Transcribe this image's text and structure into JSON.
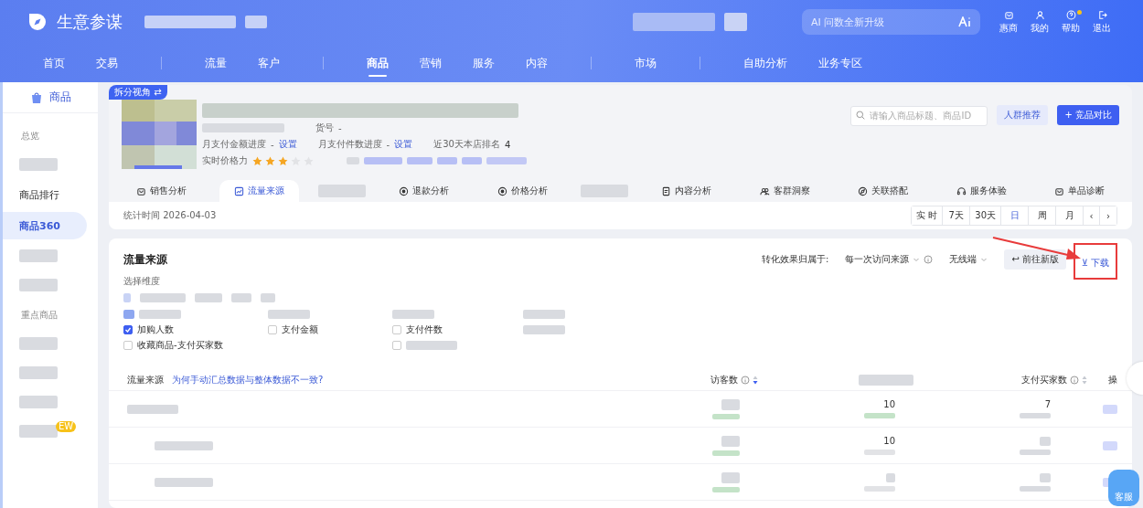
{
  "header": {
    "brand": "生意参谋",
    "ai_search": {
      "placeholder": "AI 问数全新升级"
    },
    "tools": [
      {
        "kind": "bag",
        "label": "惠商",
        "dot": false
      },
      {
        "kind": "user",
        "label": "我的",
        "dot": false
      },
      {
        "kind": "help",
        "label": "帮助",
        "dot": true
      },
      {
        "kind": "exit",
        "label": "退出",
        "dot": false
      }
    ],
    "nav": [
      {
        "label": "首页",
        "selected": false,
        "divider_after": false
      },
      {
        "label": "交易",
        "selected": false,
        "divider_after": true
      },
      {
        "label": "流量",
        "selected": false,
        "divider_after": false
      },
      {
        "label": "客户",
        "selected": false,
        "divider_after": true
      },
      {
        "label": "商品",
        "selected": true,
        "divider_after": false
      },
      {
        "label": "营销",
        "selected": false,
        "divider_after": false
      },
      {
        "label": "服务",
        "selected": false,
        "divider_after": false
      },
      {
        "label": "内容",
        "selected": false,
        "divider_after": true
      },
      {
        "label": "市场",
        "selected": false,
        "divider_after": true
      },
      {
        "label": "自助分析",
        "selected": false,
        "divider_after": false
      },
      {
        "label": "业务专区",
        "selected": false,
        "divider_after": false
      }
    ]
  },
  "sidebar": {
    "title": "商品",
    "items": [
      {
        "kind": "group",
        "label": "总览"
      },
      {
        "kind": "redacted"
      },
      {
        "kind": "item",
        "label": "商品排行",
        "selected": false
      },
      {
        "kind": "item",
        "label": "商品360",
        "selected": true
      },
      {
        "kind": "redacted"
      },
      {
        "kind": "redacted"
      },
      {
        "kind": "group",
        "label": "重点商品"
      },
      {
        "kind": "redacted"
      },
      {
        "kind": "redacted"
      },
      {
        "kind": "redacted"
      },
      {
        "kind": "redacted",
        "badge": "EW"
      }
    ]
  },
  "product": {
    "tag": "拆分视角 ⇄",
    "sku_label": "货号",
    "sku_value": "-",
    "progress": [
      {
        "label": "月支付金额进度",
        "value": "-",
        "link": "设置"
      },
      {
        "label": "月支付件数进度",
        "value": "-",
        "link": "设置"
      }
    ],
    "rank_label": "近30天本店排名",
    "rank_value": "4",
    "price_power_label": "实时价格力",
    "stars": 3,
    "search": {
      "placeholder": "请输入商品标题、商品ID"
    },
    "crowd_button": "人群推荐",
    "compare_button": "+ 竞品对比",
    "tabs": [
      {
        "kind": "tab",
        "label": "销售分析",
        "selected": false
      },
      {
        "kind": "tab",
        "label": "流量来源",
        "selected": true
      },
      {
        "kind": "redacted"
      },
      {
        "kind": "tab",
        "label": "退款分析",
        "selected": false
      },
      {
        "kind": "tab",
        "label": "价格分析",
        "selected": false
      },
      {
        "kind": "redacted"
      },
      {
        "kind": "tab",
        "label": "内容分析",
        "selected": false
      },
      {
        "kind": "tab",
        "label": "客群洞察",
        "selected": false
      },
      {
        "kind": "tab",
        "label": "关联搭配",
        "selected": false
      },
      {
        "kind": "tab",
        "label": "服务体验",
        "selected": false
      },
      {
        "kind": "tab",
        "label": "单品诊断",
        "selected": false
      }
    ],
    "stat_time": "统计时间 2026-04-03",
    "periods": [
      {
        "label": "实 时",
        "selected": false
      },
      {
        "label": "7天",
        "selected": false
      },
      {
        "label": "30天",
        "selected": false
      },
      {
        "label": "日",
        "selected": true
      },
      {
        "label": "周",
        "selected": false
      },
      {
        "label": "月",
        "selected": false
      }
    ],
    "prev": "‹",
    "next": "›"
  },
  "traffic": {
    "title": "流量来源",
    "attribution_label": "转化效果归属于:",
    "attribution_value": "每一次访问来源",
    "terminal": "无线端",
    "new_version_icon": "↩",
    "new_version": "前往新版",
    "download_icon": "⊻",
    "download": "下载",
    "dimension_label": "选择维度",
    "metrics": [
      {
        "kind": "redacted"
      },
      {
        "kind": "redacted"
      },
      {
        "kind": "redacted"
      },
      {
        "kind": "redacted"
      },
      {
        "kind": "check",
        "label": "加购人数",
        "checked": true
      },
      {
        "kind": "check",
        "label": "支付金额",
        "checked": false
      },
      {
        "kind": "check",
        "label": "支付件数",
        "checked": false
      },
      {
        "kind": "redacted"
      },
      {
        "kind": "check",
        "label": "收藏商品-支付买家数",
        "checked": false
      },
      {
        "kind": "empty"
      },
      {
        "kind": "redacted_check",
        "checked": false
      },
      {
        "kind": "empty"
      }
    ],
    "table": {
      "source_header": "流量来源",
      "help_link": "为何手动汇总数据与整体数据不一致?",
      "visitors_header": "访客数",
      "buyers_header": "支付买家数",
      "op_header": "操",
      "rows": [
        {
          "kind": "parent",
          "column_3": "10",
          "buyers": "7"
        },
        {
          "kind": "child",
          "column_3": "10"
        },
        {
          "kind": "child"
        }
      ]
    }
  },
  "service_button": "客服"
}
